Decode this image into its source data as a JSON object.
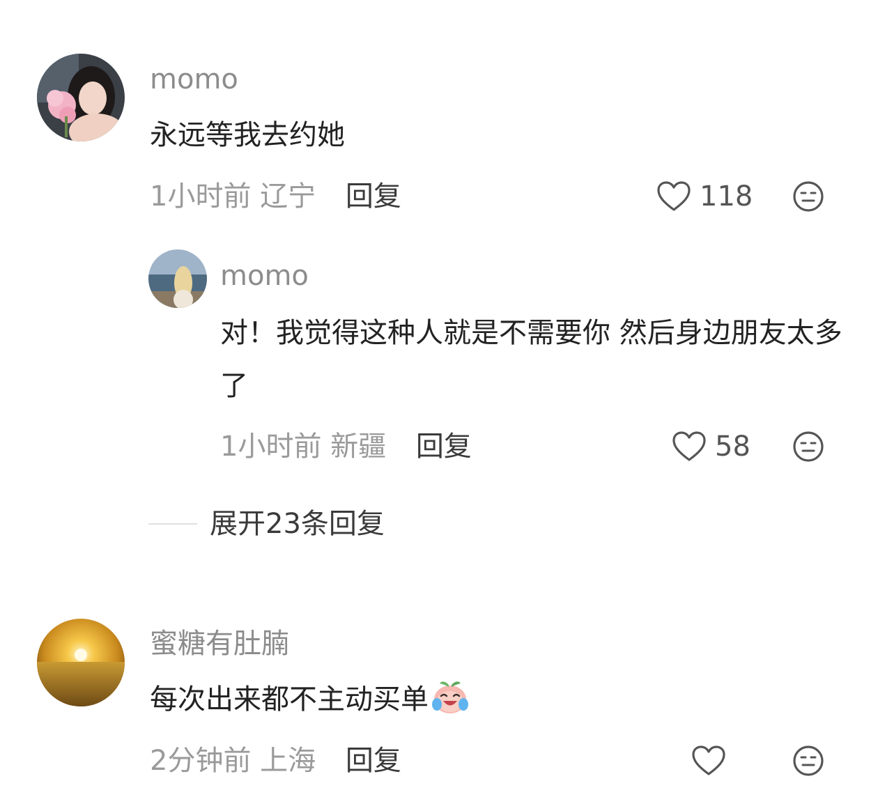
{
  "comments": [
    {
      "username": "momo",
      "text": "永远等我去约她",
      "time": "1小时前",
      "location": "辽宁",
      "reply_label": "回复",
      "likes": "118",
      "avatar_icon": "girl-with-flowers-avatar"
    },
    {
      "username": "momo",
      "text": "对！我觉得这种人就是不需要你 然后身边朋友太多了",
      "time": "1小时前",
      "location": "新疆",
      "reply_label": "回复",
      "likes": "58",
      "avatar_icon": "girl-at-sea-avatar"
    },
    {
      "username": "蜜糖有肚腩",
      "text": "每次出来都不主动买单",
      "time": "2分钟前",
      "location": "上海",
      "reply_label": "回复",
      "likes": "",
      "avatar_icon": "sunset-field-avatar",
      "emoji": "crying-laughing-peach-emoji"
    }
  ],
  "expand_replies": {
    "label": "展开23条回复"
  },
  "colors": {
    "username": "#8c8c8c",
    "text": "#222222",
    "meta": "#9a9a9a",
    "reply": "#3a3a3a",
    "icon": "#555555"
  }
}
